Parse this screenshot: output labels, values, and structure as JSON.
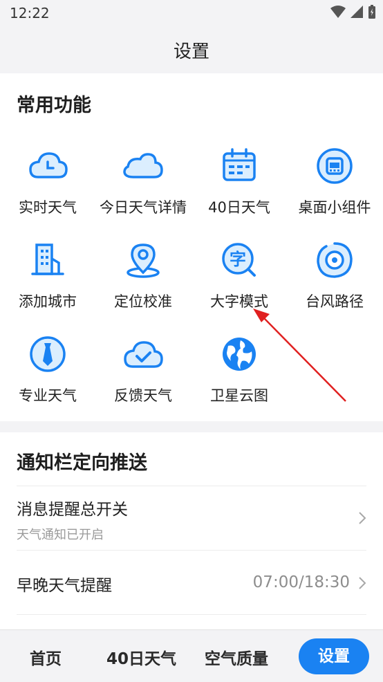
{
  "status_bar": {
    "time": "12:22"
  },
  "navbar": {
    "title": "设置"
  },
  "common": {
    "title": "常用功能",
    "items": [
      {
        "label": "实时天气",
        "icon": "cloud-clock-icon"
      },
      {
        "label": "今日天气详情",
        "icon": "cloud-icon"
      },
      {
        "label": "40日天气",
        "icon": "calendar-icon"
      },
      {
        "label": "桌面小组件",
        "icon": "widget-icon"
      },
      {
        "label": "添加城市",
        "icon": "building-icon"
      },
      {
        "label": "定位校准",
        "icon": "location-pin-icon"
      },
      {
        "label": "大字模式",
        "icon": "large-font-icon"
      },
      {
        "label": "台风路径",
        "icon": "typhoon-icon"
      },
      {
        "label": "专业天气",
        "icon": "tie-icon"
      },
      {
        "label": "反馈天气",
        "icon": "cloud-check-icon"
      },
      {
        "label": "卫星云图",
        "icon": "globe-icon"
      }
    ]
  },
  "notify": {
    "title": "通知栏定向推送",
    "master": {
      "title": "消息提醒总开关",
      "subtitle": "天气通知已开启"
    },
    "morning_evening": {
      "title": "早晚天气提醒",
      "value": "07:00/18:30"
    }
  },
  "tabbar": {
    "tabs": [
      {
        "label": "首页"
      },
      {
        "label": "40日天气"
      },
      {
        "label": "空气质量"
      },
      {
        "label": "设置"
      }
    ],
    "active_index": 3
  },
  "colors": {
    "accent": "#1a82f2",
    "annotation_arrow": "#e02020"
  }
}
